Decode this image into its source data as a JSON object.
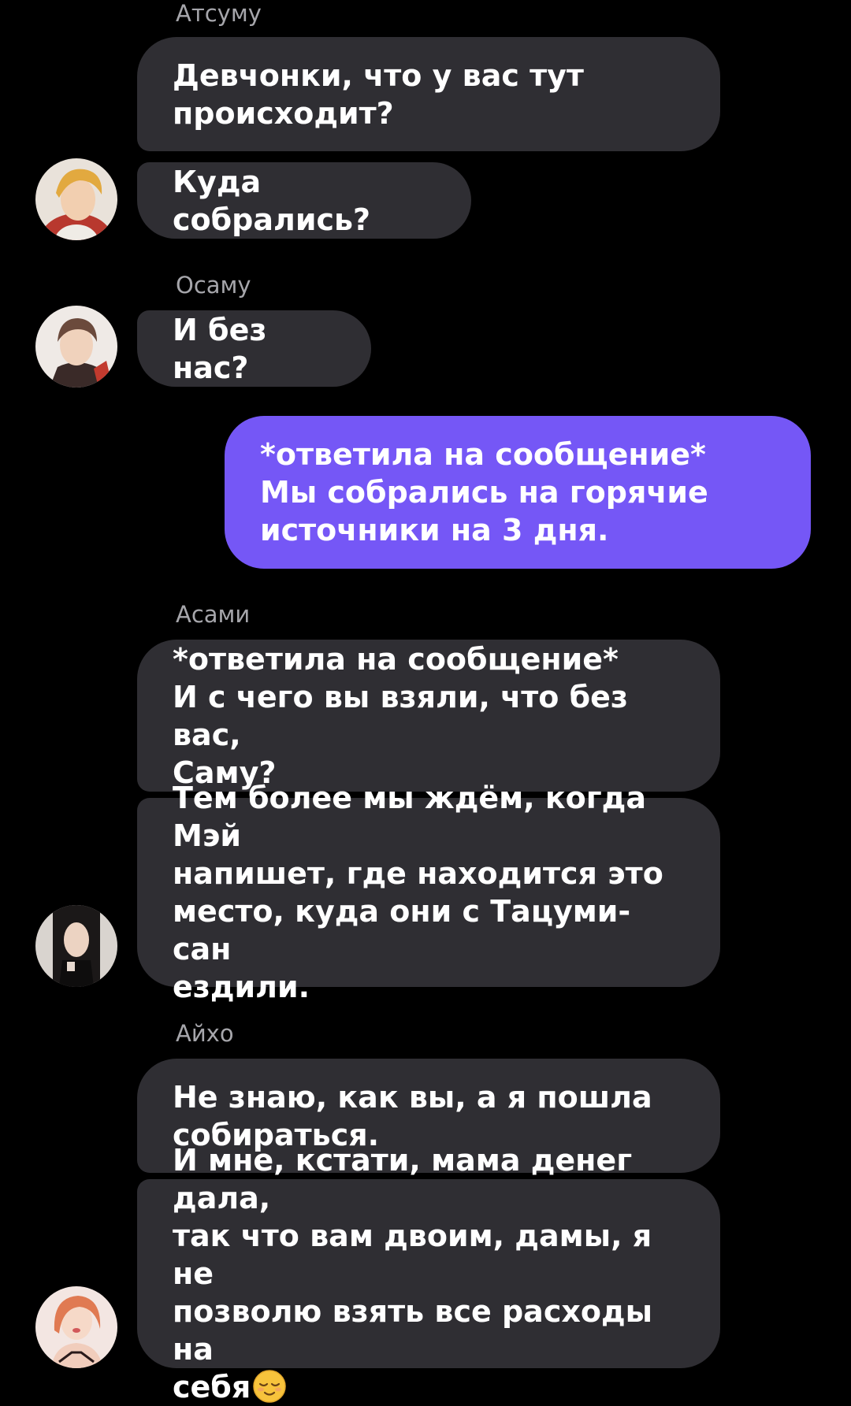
{
  "colors": {
    "background": "#000000",
    "incoming_bubble": "#2f2e33",
    "outgoing_bubble": "#7557f6",
    "sender_name": "#a6a6ab"
  },
  "messages": {
    "atsumu": {
      "sender": "Атсуму",
      "msg1": "Девчонки, что у вас тут\nпроисходит?",
      "msg2": "Куда собрались?"
    },
    "osamu": {
      "sender": "Осаму",
      "msg1": "И без нас?"
    },
    "me": {
      "msg1": "*ответила на сообщение*\nМы собрались на горячие\nисточники на 3 дня."
    },
    "asami": {
      "sender": "Асами",
      "msg1": "*ответила на сообщение*\nИ с чего вы взяли, что без вас,\nСаму?",
      "msg2": "Тем более мы ждём, когда Мэй\nнапишет, где находится это\nместо, куда они с Тацуми-сан\nездили."
    },
    "aiho": {
      "sender": "Айхо",
      "msg1": "Не знаю, как вы, а я пошла\nсобираться.",
      "msg2_text": "И мне, кстати, мама денег дала,\nтак что вам двоим, дамы, я не\nпозволю взять все расходы на\nсебя",
      "msg2_emoji": "relieved-face-emoji"
    }
  }
}
